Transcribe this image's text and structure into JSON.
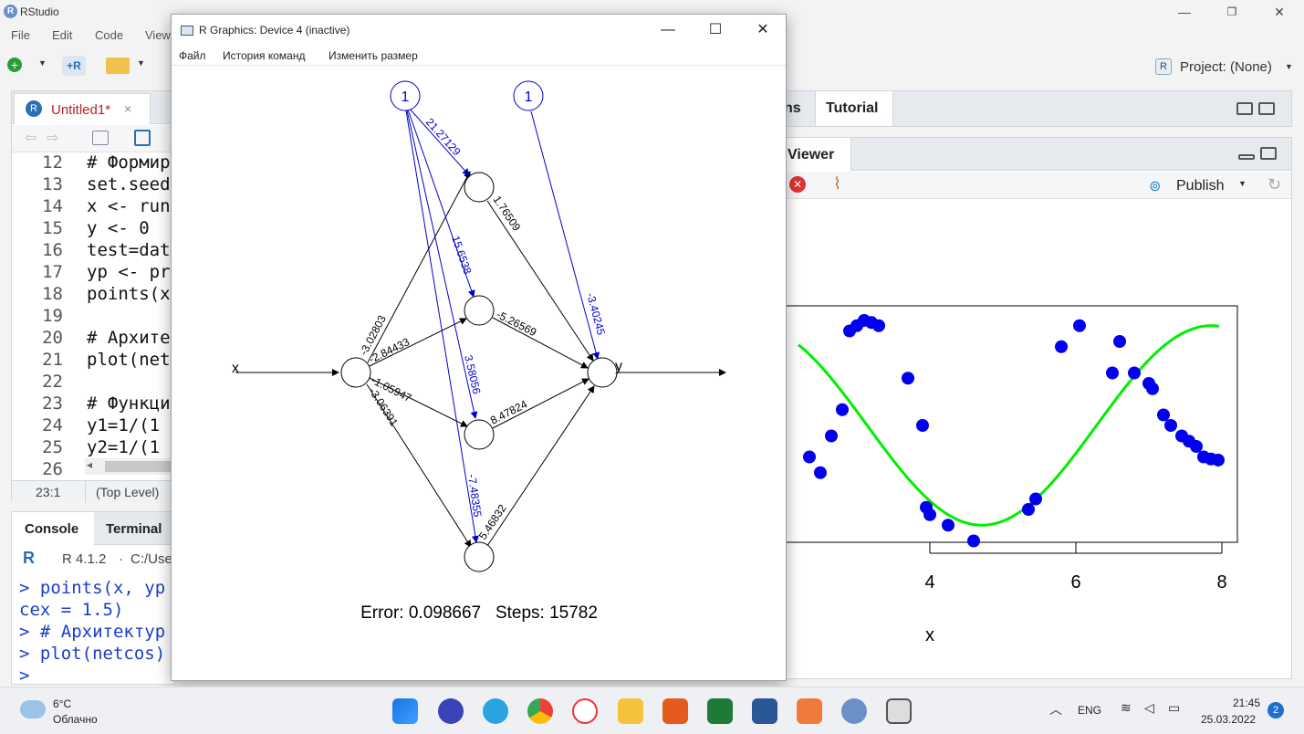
{
  "window": {
    "title": "RStudio",
    "logo": "R"
  },
  "menu": [
    "File",
    "Edit",
    "Code",
    "View"
  ],
  "toolbar": {
    "project_label": "Project: (None)",
    "project_icon": "R"
  },
  "editor": {
    "tab_label": "Untitled1*",
    "tab_close": "×",
    "lines": [
      {
        "n": "12",
        "code": "# Формир"
      },
      {
        "n": "13",
        "code": "set.seed"
      },
      {
        "n": "14",
        "code": "x <- run"
      },
      {
        "n": "15",
        "code": "y <- 0"
      },
      {
        "n": "16",
        "code": "test=dat"
      },
      {
        "n": "17",
        "code": "yp <- pr"
      },
      {
        "n": "18",
        "code": "points(x"
      },
      {
        "n": "19",
        "code": ""
      },
      {
        "n": "20",
        "code": "# Архите"
      },
      {
        "n": "21",
        "code": "plot(net"
      },
      {
        "n": "22",
        "code": ""
      },
      {
        "n": "23",
        "code": "# Функци"
      },
      {
        "n": "24",
        "code": "y1=1/(1"
      },
      {
        "n": "25",
        "code": "y2=1/(1"
      },
      {
        "n": "26",
        "code": ""
      }
    ],
    "cursor": "23:1",
    "scope": "(Top Level)"
  },
  "console": {
    "tabs": [
      "Console",
      "Terminal"
    ],
    "r_version": "R 4.1.2",
    "path": "C:/Use",
    "lines": [
      "> points(x, yp",
      "  cex = 1.5)",
      "> # Архитектур",
      "> plot(netcos)",
      ">"
    ]
  },
  "right_top_tabs": [
    "ns",
    "Tutorial"
  ],
  "viewer": {
    "tab": "Viewer",
    "publish": "Publish"
  },
  "graphics_window": {
    "title": "R Graphics: Device 4 (inactive)",
    "menu": [
      "Файл",
      "История команд",
      "Изменить размер"
    ],
    "minimize": "—",
    "maximize": "☐",
    "close": "✕"
  },
  "network": {
    "input_label": "x",
    "output_label": "y",
    "bias_label": "1",
    "weights_input_hidden": [
      "-3.02803",
      "-2.84433",
      "-1.05947",
      "-3.06391"
    ],
    "weights_bias_hidden": [
      "21.27129",
      "15.6538",
      "3.58056",
      "-7.48355"
    ],
    "weights_hidden_output": [
      "1.76509",
      "-5.26569",
      "8.47824",
      "5.46832"
    ],
    "weight_bias_output": "-3.40245",
    "error_text": "Error: 0.098667   Steps: 15782"
  },
  "chart_data": {
    "type": "scatter",
    "xlabel": "x",
    "ylabel": "",
    "x_ticks": [
      "4",
      "6",
      "8"
    ],
    "xlim_visible": [
      2.2,
      8.3
    ],
    "ylim": [
      -1.2,
      1.2
    ],
    "points_x": [
      2.35,
      2.5,
      2.65,
      2.8,
      2.9,
      3.0,
      3.1,
      3.2,
      3.3,
      3.7,
      3.9,
      3.95,
      4.0,
      4.25,
      4.6,
      5.35,
      5.45,
      5.8,
      6.05,
      6.5,
      6.6,
      6.8,
      7.0,
      7.05,
      7.2,
      7.3,
      7.45,
      7.55,
      7.65,
      7.75,
      7.85,
      7.95
    ],
    "points_y": [
      -0.3,
      -0.45,
      -0.1,
      0.15,
      0.9,
      0.95,
      1.0,
      0.98,
      0.95,
      0.45,
      0.0,
      -0.78,
      -0.85,
      -0.95,
      -1.1,
      -0.8,
      -0.7,
      0.75,
      0.95,
      0.5,
      0.8,
      0.5,
      0.4,
      0.35,
      0.1,
      0.0,
      -0.1,
      -0.15,
      -0.2,
      -0.3,
      -0.32,
      -0.33
    ],
    "curve": "sin",
    "colors": {
      "points": "#0000ee",
      "line": "#00ee00"
    }
  },
  "taskbar": {
    "temperature": "6°C",
    "weather": "Облачно",
    "language": "ENG",
    "time": "21:45",
    "date": "25.03.2022",
    "notifications": "2"
  }
}
